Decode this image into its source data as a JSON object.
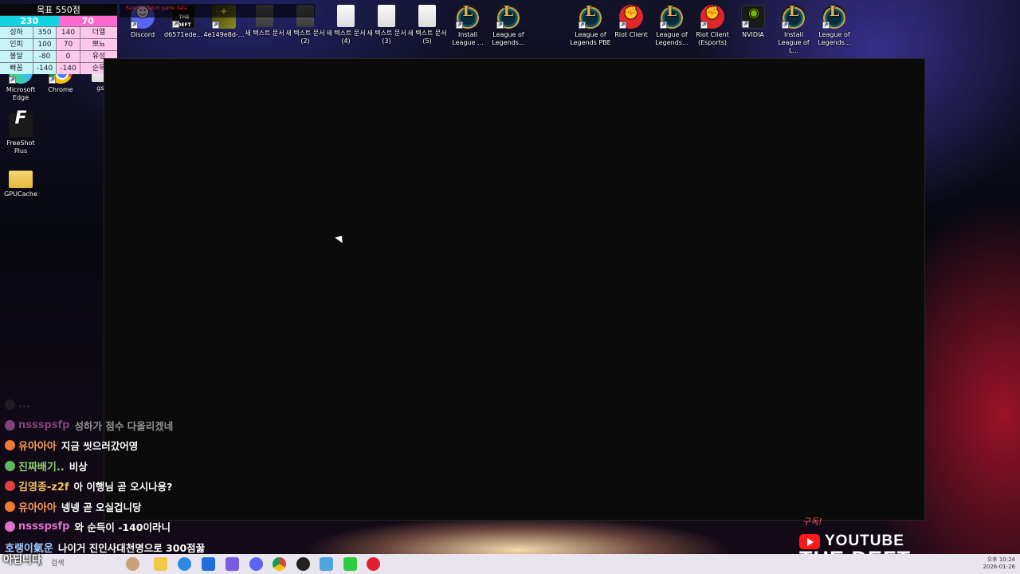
{
  "desktop": {
    "top_icons": [
      {
        "id": "discord",
        "label": "Discord",
        "type": "discord"
      },
      {
        "id": "d6571",
        "label": "d6571ede...",
        "type": "deft",
        "inner": "THE DEFT"
      },
      {
        "id": "4e149",
        "label": "4e149e8d-...",
        "type": "yel"
      },
      {
        "id": "txt1",
        "label": "새 텍스트 문서",
        "type": "doc-dark"
      },
      {
        "id": "txt2",
        "label": "새 텍스트 문서 (2)",
        "type": "doc-dark"
      },
      {
        "id": "txt4",
        "label": "새 텍스트 문서 (4)",
        "type": "doc"
      },
      {
        "id": "txt3",
        "label": "새 텍스트 문서 (3)",
        "type": "doc"
      },
      {
        "id": "txt5",
        "label": "새 텍스트 문서 (5)",
        "type": "doc"
      },
      {
        "id": "installlol1",
        "label": "Install League ...",
        "type": "lol"
      },
      {
        "id": "lol1",
        "label": "League of Legends...",
        "type": "lol"
      },
      {
        "id": "lolpbe",
        "label": "League of Legends PBE",
        "type": "lol"
      },
      {
        "id": "riot",
        "label": "Riot Client",
        "type": "riot"
      },
      {
        "id": "lol2",
        "label": "League of Legends...",
        "type": "lol"
      },
      {
        "id": "riotesports",
        "label": "Riot Client (Esports)",
        "type": "riot"
      },
      {
        "id": "nvidia",
        "label": "NVIDIA",
        "type": "nvidia"
      },
      {
        "id": "installlol2",
        "label": "Install League of L...",
        "type": "lol"
      },
      {
        "id": "lol3",
        "label": "League of Legends...",
        "type": "lol"
      }
    ],
    "left_icons": [
      {
        "id": "edge",
        "label": "Microsoft Edge",
        "type": "edge"
      },
      {
        "id": "chrome",
        "label": "Chrome",
        "type": "chrome"
      },
      {
        "id": "gs",
        "label": "gs",
        "type": "doc"
      },
      {
        "id": "freeshot",
        "label": "FreeShot Plus",
        "type": "freeshot"
      },
      {
        "id": "gpucache",
        "label": "GPUCache",
        "type": "folder"
      }
    ]
  },
  "scoreboard": {
    "title": "목표 550점",
    "left_total": "230",
    "right_total": "70",
    "rows": [
      {
        "name": "성하",
        "left": "350",
        "right": "140",
        "right_name": "더엘"
      },
      {
        "name": "인피",
        "left": "100",
        "right": "70",
        "right_name": "뽀뇨"
      },
      {
        "name": "봉달",
        "left": "-80",
        "right": "0",
        "right_name": "유성"
      },
      {
        "name": "빠꼼",
        "left": "-140",
        "right": "-140",
        "right_name": "순득"
      }
    ],
    "fetch_error": "Failed to fetch game data"
  },
  "chat": {
    "lines": [
      {
        "nick": "...",
        "msg": "",
        "nick_color": "#888888",
        "avatar_color": "#555555",
        "style": "faded"
      },
      {
        "nick": "nssspsfp",
        "msg": "성하가 점수 다올리겠네",
        "nick_color": "#e070d0",
        "avatar_color": "#e070d0",
        "style": "dim"
      },
      {
        "nick": "유아아아",
        "msg": "지금 씻으러갔어영",
        "nick_color": "#f59a5a",
        "avatar_color": "#f07a30",
        "style": ""
      },
      {
        "nick": "진짜배기..",
        "msg": "비상",
        "nick_color": "#8fd070",
        "avatar_color": "#5cb85c",
        "style": ""
      },
      {
        "nick": "김영종-z2f",
        "msg": "아 이행님 곧 오시나용?",
        "nick_color": "#f0c060",
        "avatar_color": "#e04040",
        "style": ""
      },
      {
        "nick": "유아아아",
        "msg": "넹넹 곧 오실겁니당",
        "nick_color": "#f59a5a",
        "avatar_color": "#f07a30",
        "style": ""
      },
      {
        "nick": "nssspsfp",
        "msg": "와 순득이 -140이라니",
        "nick_color": "#e070d0",
        "avatar_color": "#e070d0",
        "style": ""
      },
      {
        "nick": "호랭이氣운",
        "msg": "나이거 진인사대천명으로 300점꿇",
        "nick_color": "#a0c8ff",
        "avatar_color": "",
        "style": ""
      }
    ]
  },
  "taskbar": {
    "start_text": "아닙니다",
    "search_placeholder": "검색",
    "clock_time": "오후 10:24",
    "clock_date": "2026-01-26"
  },
  "watermark": {
    "subscribe": "구독!",
    "youtube": "YOUTUBE",
    "channel": "THE DEFT"
  }
}
